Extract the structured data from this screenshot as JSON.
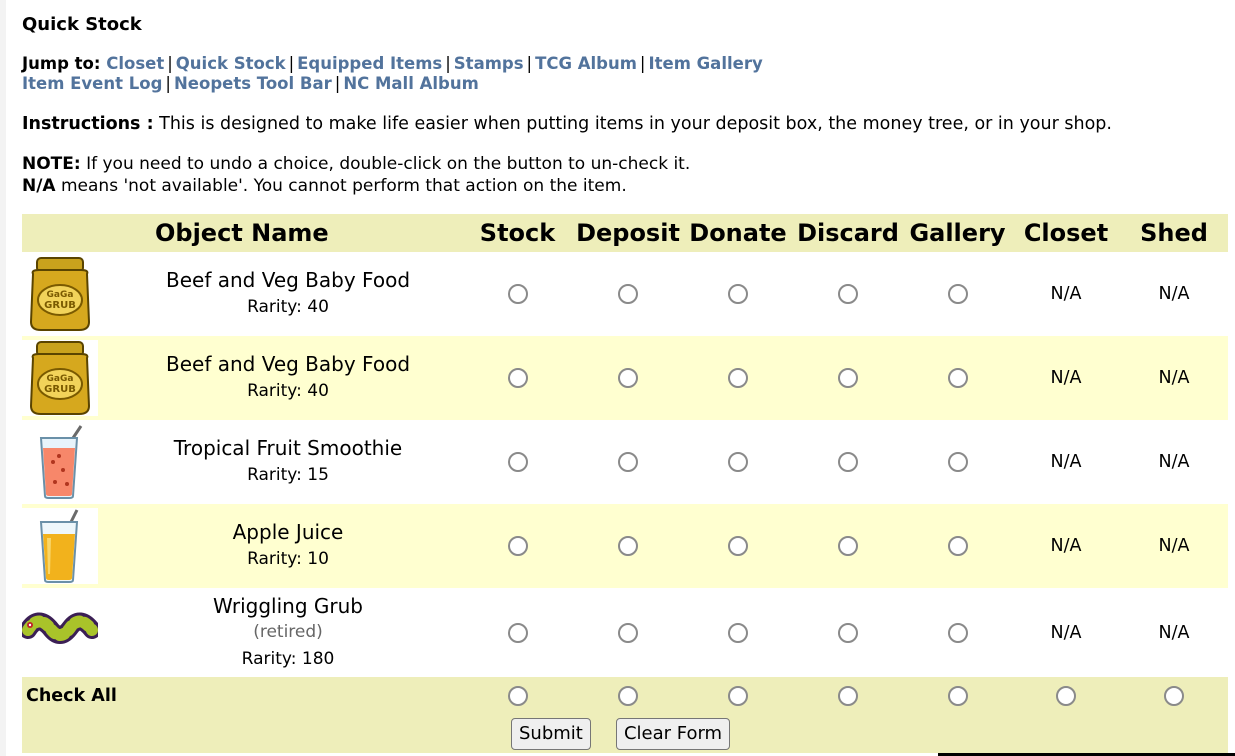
{
  "title": "Quick Stock",
  "jump": {
    "label": "Jump to:",
    "links": [
      "Closet",
      "Quick Stock",
      "Equipped Items",
      "Stamps",
      "TCG Album",
      "Item Gallery",
      "Item Event Log",
      "Neopets Tool Bar",
      "NC Mall Album"
    ]
  },
  "instructions": {
    "label": "Instructions :",
    "text": " This is designed to make life easier when putting items in your deposit box, the money tree, or in your shop."
  },
  "note": {
    "label": "NOTE:",
    "text": " If you need to undo a choice, double-click on the button to un-check it.",
    "na_label": "N/A",
    "na_text": " means 'not available'. You cannot perform that action on the item."
  },
  "table": {
    "headers": [
      "Object Name",
      "Stock",
      "Deposit",
      "Donate",
      "Discard",
      "Gallery",
      "Closet",
      "Shed"
    ],
    "na_text": "N/A",
    "rarity_prefix": "Rarity: ",
    "items": [
      {
        "name": "Beef and Veg Baby Food",
        "rarity": "40",
        "retired": "",
        "icon": "baby-food-jar-icon"
      },
      {
        "name": "Beef and Veg Baby Food",
        "rarity": "40",
        "retired": "",
        "icon": "baby-food-jar-icon"
      },
      {
        "name": "Tropical Fruit Smoothie",
        "rarity": "15",
        "retired": "",
        "icon": "smoothie-glass-icon"
      },
      {
        "name": "Apple Juice",
        "rarity": "10",
        "retired": "",
        "icon": "juice-glass-icon"
      },
      {
        "name": "Wriggling Grub",
        "rarity": "180",
        "retired": "(retired)",
        "icon": "grub-icon"
      }
    ],
    "check_all": "Check All",
    "submit": "Submit",
    "clear": "Clear Form"
  }
}
